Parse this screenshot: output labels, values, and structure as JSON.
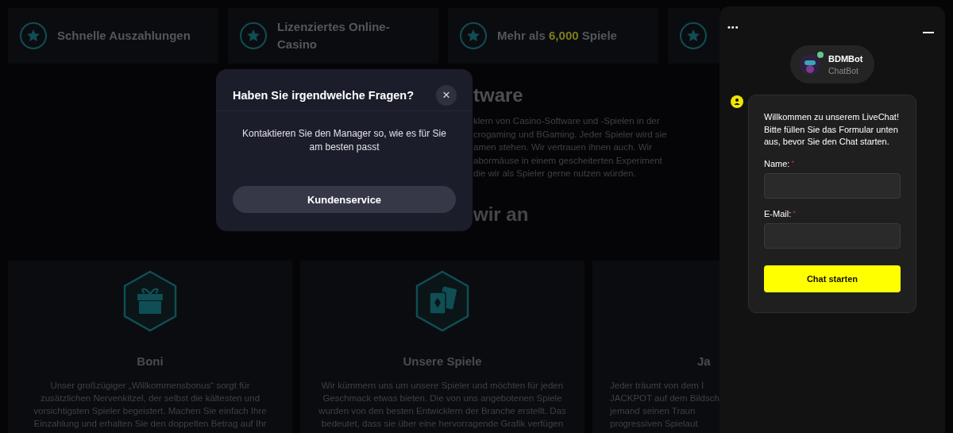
{
  "features": [
    {
      "kind": "star",
      "before": "Schnelle Auszahlungen"
    },
    {
      "kind": "star",
      "before": "Lizenziertes Online-Casino"
    },
    {
      "kind": "star",
      "before": "Mehr als ",
      "highlight": "6,000",
      "after": " Spiele"
    },
    {
      "kind": "star"
    }
  ],
  "software": {
    "heading": "tware",
    "lines": [
      "klern von Casino-Software und -Spielen in der",
      "crogaming und BGaming. Jeder Spieler wird sie",
      "amen stehen. Wir vertrauen ihnen auch. Wir",
      "abormäuse in einem gescheiterten Experiment",
      "die wir als Spieler gerne nutzen würden."
    ]
  },
  "offer_heading": "wir an",
  "offers": [
    {
      "kind": "gift",
      "title": "Boni",
      "lines": [
        "Unser großzügiger „Willkommensbonus“ sorgt für",
        "zusätzlichen Nervenkitzel, der selbst die kältesten und",
        "vorsichtigsten Spieler begeistert. Machen Sie einfach Ihre",
        "Einzahlung und erhalten Sie den doppelten Betrag auf Ihr"
      ]
    },
    {
      "kind": "cards",
      "title": "Unsere Spiele",
      "lines": [
        "Wir kümmern uns um unsere Spieler und möchten für jeden",
        "Geschmack etwas bieten. Die von uns angebotenen Spiele",
        "wurden von den besten Entwicklern der Branche erstellt. Das",
        "bedeutet, dass sie über eine hervorragende Grafik verfügen"
      ]
    },
    {
      "kind": "partial",
      "title": "Ja",
      "lines": [
        "Jeder träumt von dem I",
        "JACKPOT auf dem Bildsch",
        "jemand seinen Traun",
        "progressiven Spielaut"
      ]
    }
  ],
  "modal": {
    "title": "Haben Sie irgendwelche Fragen?",
    "close": "×",
    "message": "Kontaktieren Sie den Manager so, wie es für Sie am besten passt",
    "button": "Kundenservice"
  },
  "chat": {
    "menu": "•••",
    "bot_name": "BDMBot",
    "bot_role": "ChatBot",
    "online": true,
    "welcome": "Willkommen zu unserem LiveChat! Bitte füllen Sie das Formular unten aus, bevor Sie den Chat starten.",
    "fields": [
      {
        "label": "Name:",
        "required_mark": "*"
      },
      {
        "label": "E-Mail:",
        "required_mark": "*"
      }
    ],
    "button": "Chat starten"
  }
}
